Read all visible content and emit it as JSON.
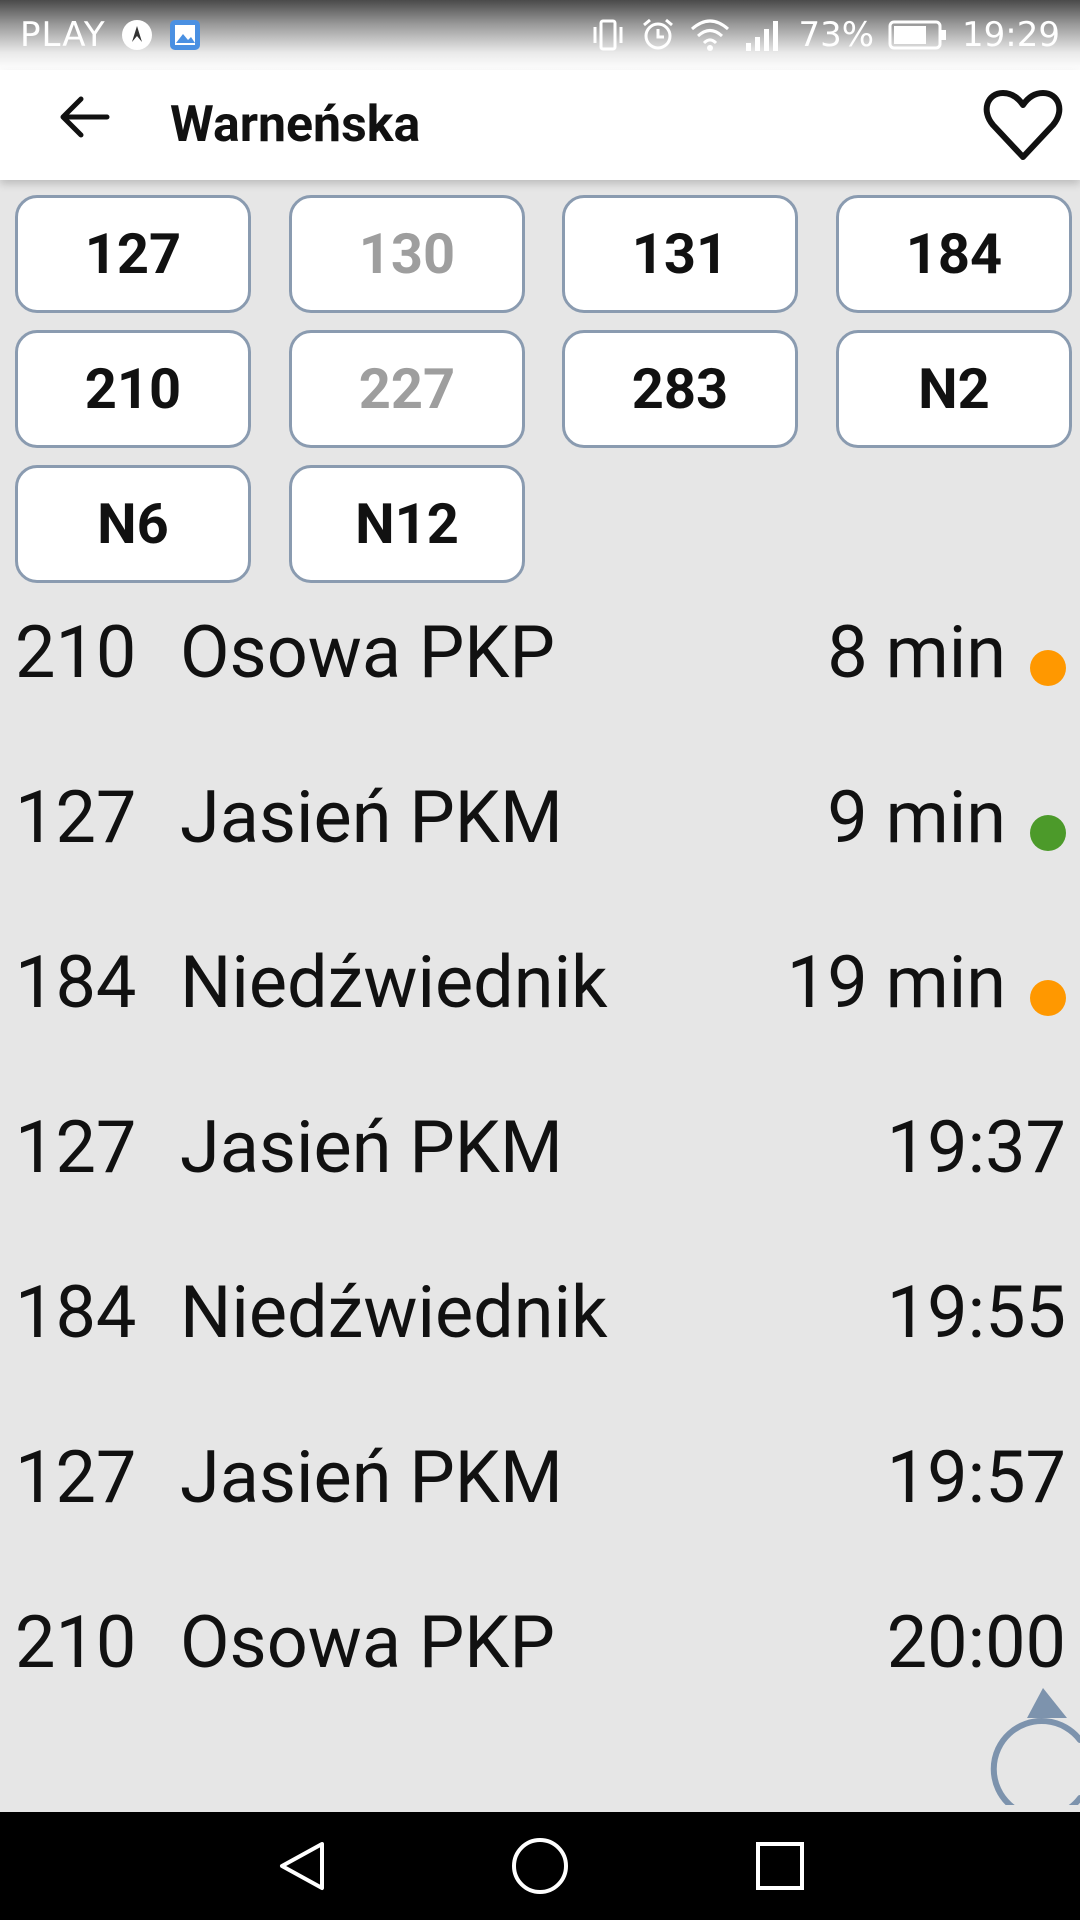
{
  "status_bar": {
    "carrier": "PLAY",
    "battery": "73%",
    "time": "19:29"
  },
  "header": {
    "title": "Warneńska"
  },
  "route_filters": [
    {
      "label": "127",
      "enabled": true
    },
    {
      "label": "130",
      "enabled": false
    },
    {
      "label": "131",
      "enabled": true
    },
    {
      "label": "184",
      "enabled": true
    },
    {
      "label": "210",
      "enabled": true
    },
    {
      "label": "227",
      "enabled": false
    },
    {
      "label": "283",
      "enabled": true
    },
    {
      "label": "N2",
      "enabled": true
    },
    {
      "label": "N6",
      "enabled": true
    },
    {
      "label": "N12",
      "enabled": true
    }
  ],
  "departures": [
    {
      "route": "210",
      "destination": "Osowa PKP",
      "time": "8 min",
      "status_color": "#ff9800"
    },
    {
      "route": "127",
      "destination": "Jasień PKM",
      "time": "9 min",
      "status_color": "#4c9a2a"
    },
    {
      "route": "184",
      "destination": "Niedźwiednik",
      "time": "19 min",
      "status_color": "#ff9800"
    },
    {
      "route": "127",
      "destination": "Jasień PKM",
      "time": "19:37"
    },
    {
      "route": "184",
      "destination": "Niedźwiednik",
      "time": "19:55"
    },
    {
      "route": "127",
      "destination": "Jasień PKM",
      "time": "19:57"
    },
    {
      "route": "210",
      "destination": "Osowa PKP",
      "time": "20:00"
    }
  ],
  "colors": {
    "chip_border": "#8a9bb0",
    "disabled_text": "#9e9e9e",
    "refresh": "#7d93ad"
  }
}
